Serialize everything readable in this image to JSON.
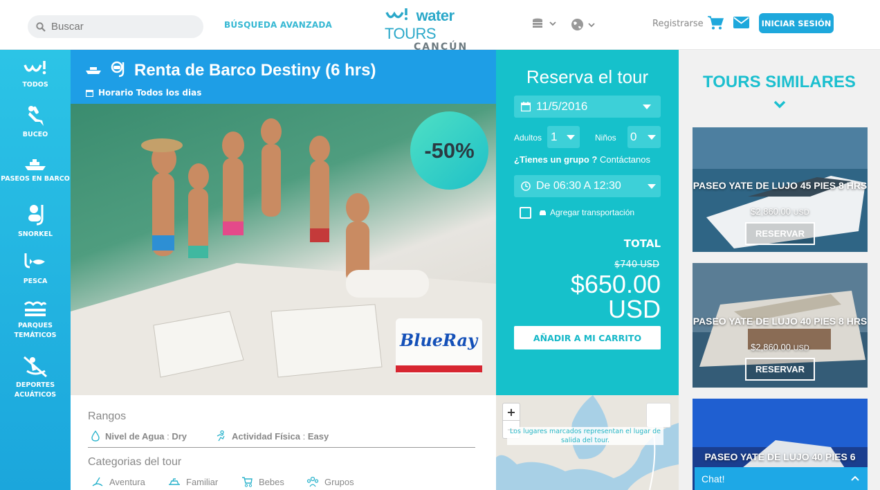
{
  "header": {
    "search_placeholder": "Buscar",
    "advanced_search": "BÚSQUEDA AVANZADA",
    "logo_main_bold": "water",
    "logo_main_light": "TOURS",
    "logo_city": "CANCÚN",
    "register": "Registrarse",
    "login": "INICIAR SESIÓN"
  },
  "sidebar": {
    "items": [
      {
        "label": "TODOS",
        "icon": "water-logo-icon"
      },
      {
        "label": "BUCEO",
        "icon": "diver-icon"
      },
      {
        "label": "PASEOS EN BARCO",
        "icon": "boat-icon"
      },
      {
        "label": "SNORKEL",
        "icon": "snorkel-icon"
      },
      {
        "label": "PESCA",
        "icon": "fishing-icon"
      },
      {
        "label": "PARQUES TEMÁTICOS",
        "icon": "park-icon"
      },
      {
        "label": "DEPORTES ACUÁTICOS",
        "icon": "kayak-icon"
      }
    ]
  },
  "tour": {
    "title": "Renta de Barco Destiny (6 hrs)",
    "schedule": "Horario Todos los dias",
    "discount": "-50%"
  },
  "booking": {
    "heading": "Reserva el tour",
    "date": "11/5/2016",
    "adults_label": "Adultos",
    "adults_value": "1",
    "children_label": "Niños",
    "children_value": "0",
    "group_question": "¿Tienes un grupo ?",
    "group_link": "Contáctanos",
    "time": "De 06:30 A 12:30",
    "transport": "Agregar transportación",
    "total_label": "TOTAL",
    "old_price": "$740 USD",
    "price": "$650.00",
    "currency": "USD",
    "add_cart": "AÑADIR A MI CARRITO"
  },
  "similar": {
    "heading": "TOURS SIMILARES",
    "cards": [
      {
        "title": "PASEO YATE DE LUJO 45 PIES 8 HRS",
        "price": "$2,860.00",
        "currency": "USD",
        "button": "RESERVAR"
      },
      {
        "title": "PASEO YATE DE LUJO 40 PIES 8 HRS",
        "price": "$2,860.00",
        "currency": "USD",
        "button": "RESERVAR"
      },
      {
        "title": "PASEO YATE DE LUJO 40 PIES 6",
        "price": "",
        "currency": "",
        "button": ""
      }
    ]
  },
  "info": {
    "ranges_heading": "Rangos",
    "water_label": "Nivel de Agua",
    "water_value": "Dry",
    "activity_label": "Actividad Física",
    "activity_value": "Easy",
    "categories_heading": "Categorias del tour",
    "categories": [
      "Aventura",
      "Familiar",
      "Bebes",
      "Grupos"
    ]
  },
  "map": {
    "zoom_in": "+",
    "zoom_out": "−",
    "note": "Los lugares marcados representan el lugar de salida del tour."
  },
  "chat": {
    "label": "Chat!"
  },
  "colors": {
    "accent": "#1ea8dc",
    "booking": "#16c1cb",
    "sidebar": "#2cc4e6",
    "title_bar": "#1e9ee6"
  }
}
